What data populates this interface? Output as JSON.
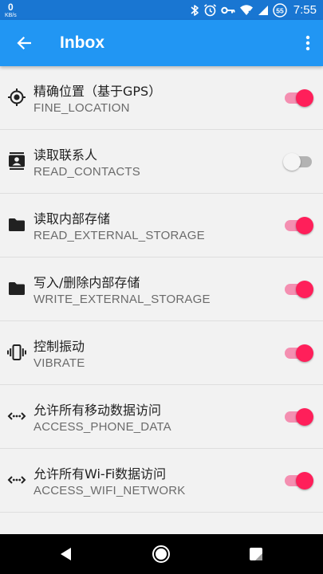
{
  "status_bar": {
    "net_speed": "0",
    "net_unit": "KB/s",
    "time": "7:55",
    "battery_level": "55",
    "icons": [
      "bluetooth-icon",
      "alarm-icon",
      "key-icon",
      "wifi-icon",
      "signal-icon",
      "battery-icon"
    ]
  },
  "app_bar": {
    "title": "Inbox",
    "back_icon": "arrow-back-icon",
    "menu_icon": "more-vert-icon"
  },
  "colors": {
    "status_bar": "#1976d2",
    "app_bar": "#2196f3",
    "toggle_on_thumb": "#ff1f5a",
    "toggle_on_track": "#f48fb1",
    "toggle_off_thumb": "#f5f5f5",
    "toggle_off_track": "#b3b3b3"
  },
  "permissions": [
    {
      "name": "精确位置（基于GPS）",
      "code": "FINE_LOCATION",
      "icon": "gps-icon",
      "enabled": true
    },
    {
      "name": "读取联系人",
      "code": "READ_CONTACTS",
      "icon": "contacts-icon",
      "enabled": false
    },
    {
      "name": "读取内部存储",
      "code": "READ_EXTERNAL_STORAGE",
      "icon": "folder-icon",
      "enabled": true
    },
    {
      "name": "写入/删除内部存储",
      "code": "WRITE_EXTERNAL_STORAGE",
      "icon": "folder-icon",
      "enabled": true
    },
    {
      "name": "控制振动",
      "code": "VIBRATE",
      "icon": "vibration-icon",
      "enabled": true
    },
    {
      "name": "允许所有移动数据访问",
      "code": "ACCESS_PHONE_DATA",
      "icon": "data-access-icon",
      "enabled": true
    },
    {
      "name": "允许所有Wi-Fi数据访问",
      "code": "ACCESS_WIFI_NETWORK",
      "icon": "data-access-icon",
      "enabled": true
    },
    {
      "name": "",
      "code": "",
      "icon": "",
      "enabled": false
    }
  ],
  "nav_bar": {
    "back_icon": "nav-back-icon",
    "home_icon": "nav-home-icon",
    "recents_icon": "nav-recents-icon"
  }
}
